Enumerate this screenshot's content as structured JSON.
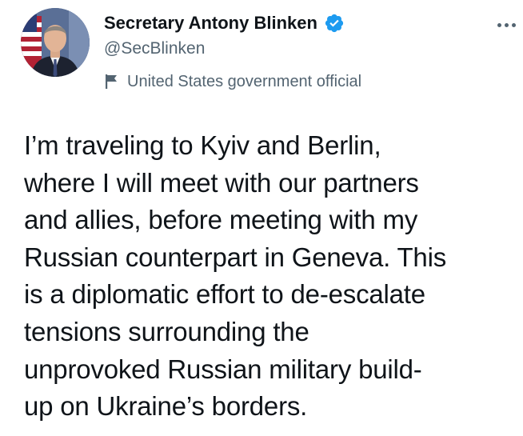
{
  "author": {
    "display_name": "Secretary Antony Blinken",
    "handle": "@SecBlinken",
    "verified_icon": "verified-badge-icon",
    "avatar_icon": "profile-photo"
  },
  "account_label": {
    "icon": "flag-icon",
    "text": "United States government official"
  },
  "menu": {
    "icon": "more-options-icon"
  },
  "tweet": {
    "text": "I’m traveling to Kyiv and Berlin,\nwhere I will meet with our partners\nand allies, before meeting with my\nRussian counterpart in Geneva. This\nis a diplomatic effort to de-escalate\ntensions surrounding the\nunprovoked Russian military build-\nup on Ukraine’s borders."
  },
  "colors": {
    "verified_blue": "#1d9bf0",
    "secondary_text": "#536471",
    "primary_text": "#0f1419"
  }
}
